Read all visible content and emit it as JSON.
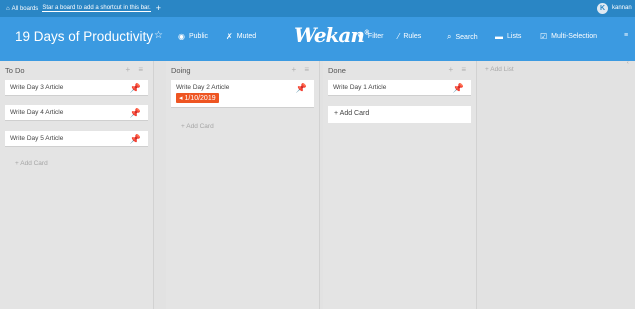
{
  "topbar": {
    "all_boards": "All boards",
    "hint": "Star a board to add a shortcut in this bar.",
    "plus": "+",
    "avatar_initial": "K",
    "username": "kannan"
  },
  "header": {
    "board_title": "19 Days of Productivity",
    "star": "☆",
    "public_label": "Public",
    "muted_label": "Muted",
    "logo_text": "Wekan",
    "logo_tm": "®",
    "filter_label": "Filter",
    "rules_label": "Rules",
    "search_label": "Search",
    "lists_label": "Lists",
    "multiselect_label": "Multi-Selection",
    "menu_icon": "≡"
  },
  "lists": [
    {
      "title": "To Do",
      "cards": [
        {
          "text": "Write Day 3 Article"
        },
        {
          "text": "Write Day 4 Article"
        },
        {
          "text": "Write Day 5 Article"
        }
      ],
      "add_card": "+ Add Card"
    },
    {
      "title": "Doing",
      "cards": [
        {
          "text": "Write Day 2 Article",
          "due": "1/10/2019"
        }
      ],
      "add_card": "+ Add Card"
    },
    {
      "title": "Done",
      "cards": [
        {
          "text": "Write Day 1 Article"
        }
      ],
      "add_card": "+ Add Card"
    }
  ],
  "add_list": "+ Add List",
  "list_controls": "+ ≡",
  "colors": {
    "topbar": "#2a86c5",
    "header": "#3b9ae1",
    "due_badge": "#ee5522",
    "pin_green": "#78b63f",
    "pin_yellow": "#e6c229"
  }
}
